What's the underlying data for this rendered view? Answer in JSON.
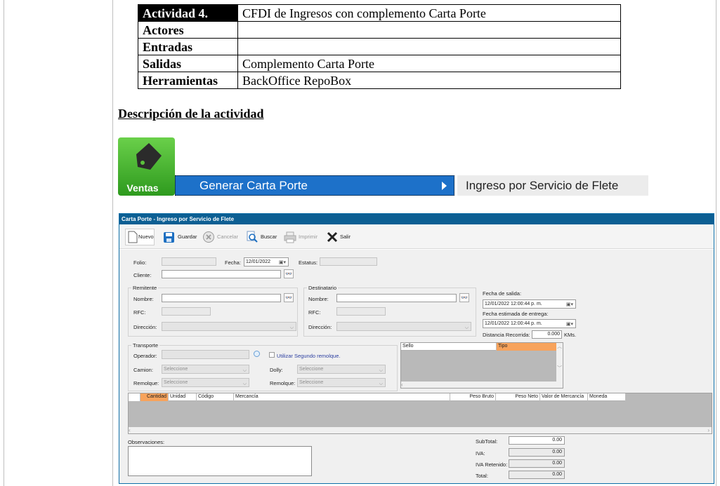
{
  "activity": {
    "rows": [
      {
        "key": "Actividad 4.",
        "value": "CFDI de Ingresos con complemento Carta Porte"
      },
      {
        "key": "Actores",
        "value": ""
      },
      {
        "key": "Entradas",
        "value": ""
      },
      {
        "key": "Salidas",
        "value": "Complemento Carta Porte"
      },
      {
        "key": "Herramientas",
        "value": "BackOffice RepoBox"
      }
    ]
  },
  "description_title": "Descripción de la actividad",
  "ventas_label": "Ventas",
  "menu": {
    "item": "Generar Carta Porte",
    "submenu": "Ingreso por Servicio de Flete"
  },
  "window": {
    "title": "Carta Porte - Ingreso por Servicio de Flete",
    "toolbar": {
      "nuevo": "Nuevo",
      "guardar": "Guardar",
      "cancelar": "Cancelar",
      "buscar": "Buscar",
      "imprimir": "Imprimir",
      "salir": "Salir"
    },
    "form": {
      "folio_label": "Folio:",
      "fecha_label": "Fecha:",
      "fecha_value": "12/01/2022",
      "estatus_label": "Estatus:",
      "cliente_label": "Cliente:",
      "remitente": {
        "title": "Remitente",
        "nombre_label": "Nombre:",
        "rfc_label": "RFC:",
        "direccion_label": "Dirección:"
      },
      "destinatario": {
        "title": "Destinatario",
        "nombre_label": "Nombre:",
        "rfc_label": "RFC:",
        "direccion_label": "Dirección:"
      },
      "fecha_salida_label": "Fecha de salida:",
      "fecha_salida_value": "12/01/2022 12:00:44 p. m.",
      "fecha_entrega_label": "Fecha estimada de entrega:",
      "fecha_entrega_value": "12/01/2022 12:00:44 p. m.",
      "distancia_label": "Distancia Recorrida:",
      "distancia_value": "0.000",
      "distancia_unit": "KMs.",
      "transporte": {
        "title": "Transporte",
        "operador_label": "Operador:",
        "segundo_remolque_label": "Utilizar Segundo remolque.",
        "camion_label": "Camion:",
        "camion_value": "Seleccione",
        "dolly_label": "Dolly:",
        "dolly_value": "Seleccione",
        "remolque1_label": "Remolque:",
        "remolque1_value": "Seleccione",
        "remolque2_label": "Remolque:",
        "remolque2_value": "Seleccione"
      },
      "sello_grid": {
        "columns": [
          "Sello",
          "Tipo"
        ]
      },
      "items_grid": {
        "columns": [
          "Cantidad",
          "Unidad",
          "Código",
          "Mercancía",
          "Peso Bruto",
          "Peso Neto",
          "Valor de Mercancía",
          "Moneda"
        ]
      },
      "observaciones_label": "Observaciones:",
      "totals": {
        "subtotal_label": "SubTotal:",
        "subtotal": "0.00",
        "iva_label": "IVA:",
        "iva": "0.00",
        "iva_retenido_label": "IVA Retenido:",
        "iva_retenido": "0.00",
        "total_label": "Total:",
        "total": "0.00"
      }
    }
  },
  "colors": {
    "titlebar": "#0c5f93",
    "menu_highlight": "#1d71c9",
    "grid_header_highlight": "#f7a35c",
    "ventas_green": "#4cb833"
  }
}
